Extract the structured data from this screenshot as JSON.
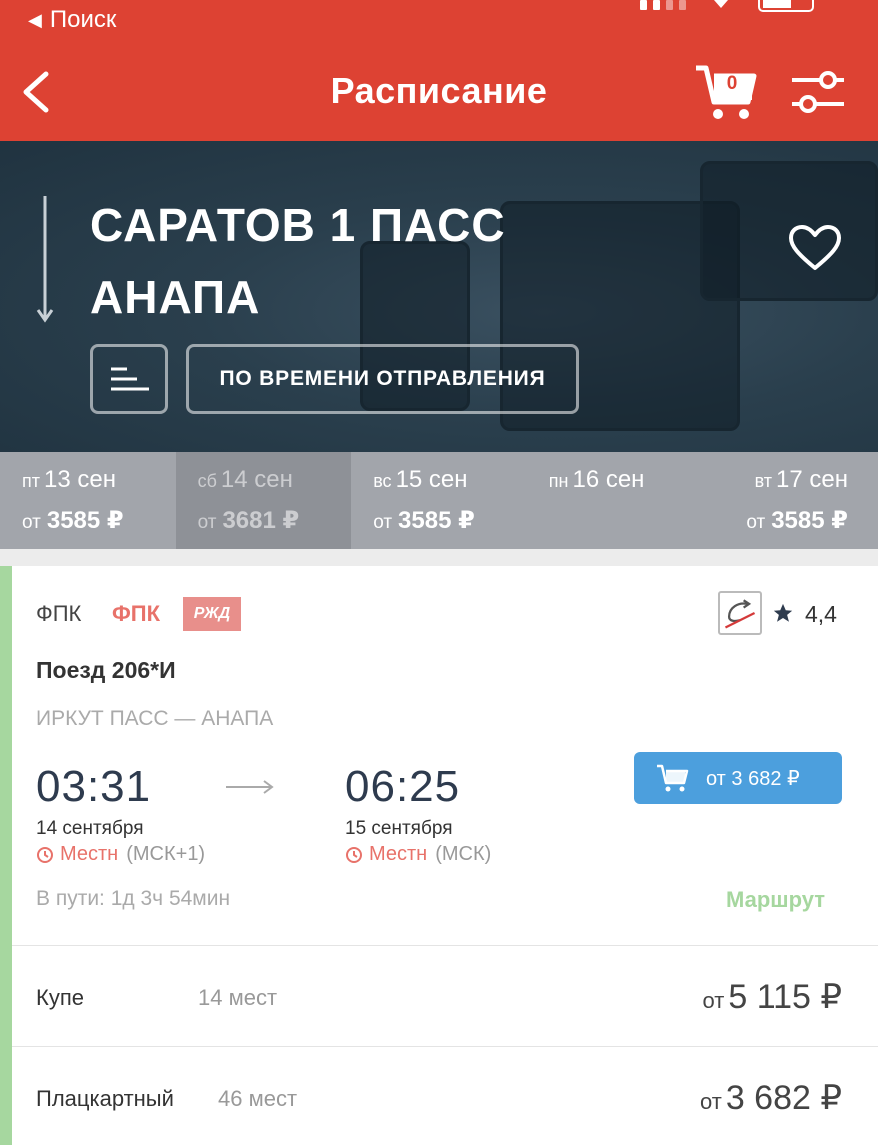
{
  "status": {
    "back_label": "Поиск"
  },
  "nav": {
    "title": "Расписание",
    "cart_count": "0"
  },
  "hero": {
    "from_station": "САРАТОВ 1 ПАСС",
    "to_station": "АНАПА",
    "sort_label": "ПО ВРЕМЕНИ ОТПРАВЛЕНИЯ"
  },
  "dates": [
    {
      "dow": "пт",
      "day": "13 сен",
      "ot": "от",
      "price": "3585 ₽"
    },
    {
      "dow": "сб",
      "day": "14 сен",
      "ot": "от",
      "price": "3681 ₽"
    },
    {
      "dow": "вс",
      "day": "15 сен",
      "ot": "от",
      "price": "3585 ₽"
    },
    {
      "dow": "пн",
      "day": "16 сен",
      "ot": "",
      "price": ""
    },
    {
      "dow": "вт",
      "day": "17 сен",
      "ot": "от",
      "price": "3585 ₽"
    }
  ],
  "train": {
    "carrier": "ФПК",
    "carrier_brand": "ФПК",
    "rzd_logo": "РЖД",
    "rating": "4,4",
    "name": "Поезд 206*И",
    "route": "ИРКУТ ПАСС — АНАПА",
    "depart_time": "03:31",
    "depart_date": "14 сентября",
    "depart_local": "Местн",
    "depart_tz": "(МСК+1)",
    "arrive_time": "06:25",
    "arrive_date": "15 сентября",
    "arrive_local": "Местн",
    "arrive_tz": "(МСК)",
    "buy_label": "от 3 682 ₽",
    "travel_time": "В пути: 1д 3ч 54мин",
    "route_link": "Маршрут"
  },
  "seats": [
    {
      "class": "Купе",
      "count": "14 мест",
      "ot": "от",
      "price": "5 115 ₽"
    },
    {
      "class": "Плацкартный",
      "count": "46 мест",
      "ot": "от",
      "price": "3 682 ₽"
    }
  ],
  "colors": {
    "brand": "#dd4233",
    "accent_green": "#a6d79f",
    "button_blue": "#4c9fdd",
    "local_red": "#e8726a"
  }
}
